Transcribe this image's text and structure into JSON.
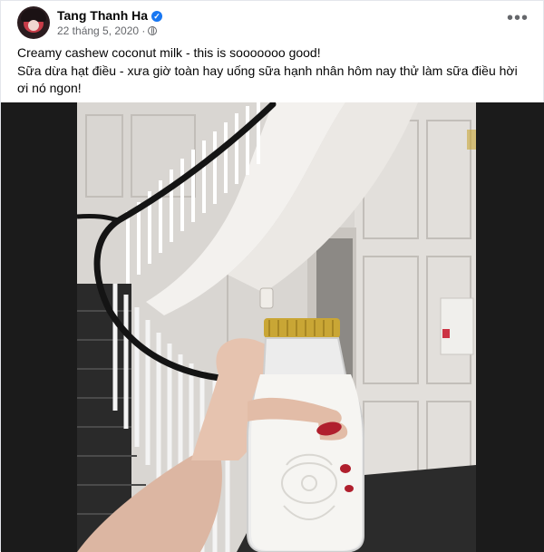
{
  "post": {
    "author": "Tang Thanh Ha",
    "verified_icon": "verified-badge-icon",
    "date": "22 tháng 5, 2020",
    "audience_icon": "globe-icon",
    "more_icon": "more-options-icon",
    "line1": "Creamy cashew coconut milk - this is sooooooo good!",
    "line2": "Sữa dừa hạt điều - xưa giờ toàn hay uống sữa hạnh nhân hôm nay thử làm sữa điều hời ơi nó ngon!"
  },
  "photo": {
    "description_icon": "milk-bottle-photo"
  },
  "colors": {
    "accent": "#1877f2",
    "meta_text": "#65676b",
    "nail_polish": "#b01f2d",
    "bottle_cap": "#c9a635"
  }
}
